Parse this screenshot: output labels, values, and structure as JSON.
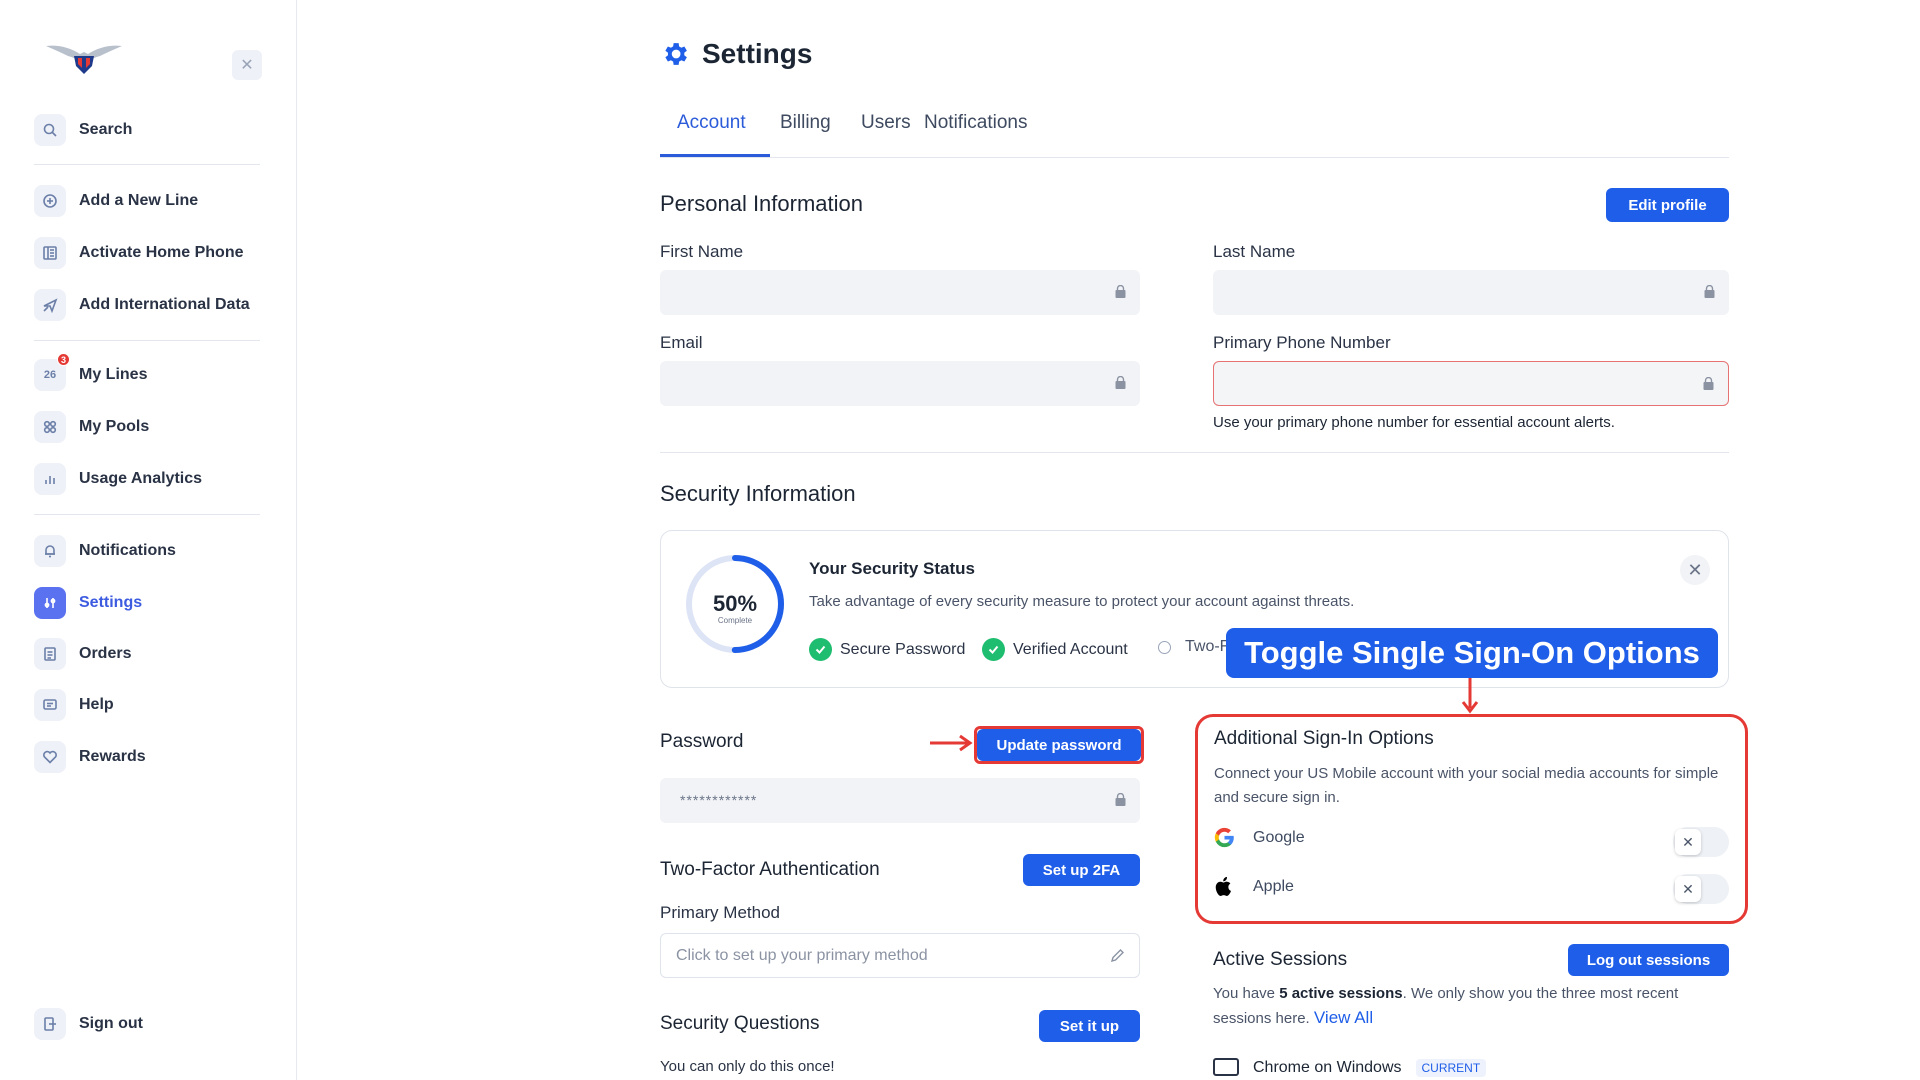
{
  "sidebar": {
    "items": [
      {
        "label": "Search",
        "icon": "search-icon"
      },
      {
        "label": "Add a New Line",
        "icon": "plus-circle-icon"
      },
      {
        "label": "Activate Home Phone",
        "icon": "home-phone-icon"
      },
      {
        "label": "Add International Data",
        "icon": "airplane-icon"
      },
      {
        "label": "My Lines",
        "icon": "lines-icon",
        "badge": "3",
        "icon_text": "26"
      },
      {
        "label": "My Pools",
        "icon": "pools-icon"
      },
      {
        "label": "Usage Analytics",
        "icon": "chart-icon"
      },
      {
        "label": "Notifications",
        "icon": "bell-icon"
      },
      {
        "label": "Settings",
        "icon": "settings-icon",
        "active": true
      },
      {
        "label": "Orders",
        "icon": "orders-icon"
      },
      {
        "label": "Help",
        "icon": "help-icon"
      },
      {
        "label": "Rewards",
        "icon": "heart-icon"
      }
    ],
    "sign_out": "Sign out"
  },
  "page": {
    "title": "Settings",
    "tabs": [
      "Account",
      "Billing",
      "Users",
      "Notifications"
    ],
    "active_tab": "Account"
  },
  "personal": {
    "title": "Personal Information",
    "edit_button": "Edit profile",
    "first_name_label": "First Name",
    "last_name_label": "Last Name",
    "email_label": "Email",
    "phone_label": "Primary Phone Number",
    "phone_helper": "Use your primary phone number for essential account alerts."
  },
  "security": {
    "title": "Security Information",
    "percent": "50%",
    "percent_value": 0.5,
    "complete_label": "Complete",
    "status_title": "Your Security Status",
    "status_desc": "Take advantage of every security measure to protect your account against threats.",
    "checks": [
      "Secure Password",
      "Verified Account",
      "Two-F"
    ]
  },
  "callout": "Toggle Single Sign-On Options",
  "password": {
    "label": "Password",
    "update_button": "Update password",
    "masked_value": "************"
  },
  "two_factor": {
    "title": "Two-Factor Authentication",
    "button": "Set up 2FA",
    "method_label": "Primary Method",
    "method_placeholder": "Click to set up your primary method"
  },
  "security_questions": {
    "title": "Security Questions",
    "button": "Set it up",
    "note": "You can only do this once!"
  },
  "sign_in_options": {
    "title": "Additional Sign-In Options",
    "desc": "Connect your US Mobile account with your social media accounts for simple and secure sign in.",
    "providers": [
      {
        "name": "Google",
        "icon": "google-icon",
        "enabled": false
      },
      {
        "name": "Apple",
        "icon": "apple-icon",
        "enabled": false
      }
    ]
  },
  "sessions": {
    "title": "Active Sessions",
    "button": "Log out sessions",
    "text_before": "You have ",
    "count_text": "5 active sessions",
    "text_after": ". We only show you the three most recent sessions here. ",
    "view_all": "View All",
    "first_session": "Chrome on Windows",
    "current_tag": "CURRENT"
  },
  "colors": {
    "accent": "#1f5ee8",
    "highlight": "#e53935",
    "success": "#1fbd6f"
  }
}
